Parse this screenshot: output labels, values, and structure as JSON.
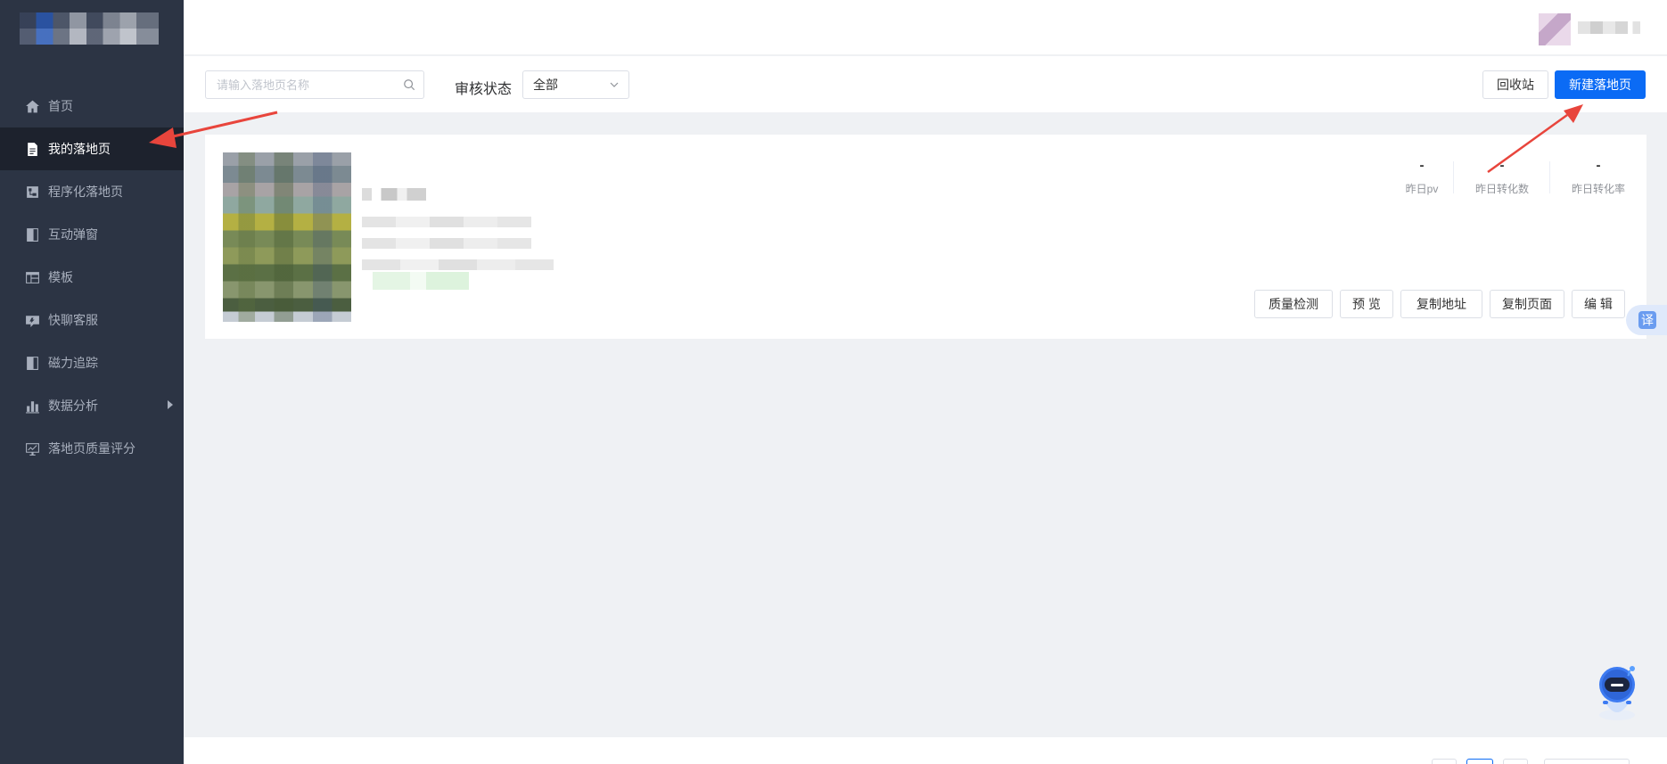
{
  "sidebar": {
    "items": [
      {
        "label": "首页",
        "icon": "home-icon",
        "active": false
      },
      {
        "label": "我的落地页",
        "icon": "document-icon",
        "active": true
      },
      {
        "label": "程序化落地页",
        "icon": "flowchart-icon",
        "active": false
      },
      {
        "label": "互动弹窗",
        "icon": "popup-icon",
        "active": false
      },
      {
        "label": "模板",
        "icon": "template-icon",
        "active": false
      },
      {
        "label": "快聊客服",
        "icon": "chat-icon",
        "active": false
      },
      {
        "label": "磁力追踪",
        "icon": "tracking-icon",
        "active": false
      },
      {
        "label": "数据分析",
        "icon": "bar-chart-icon",
        "active": false,
        "has_submenu": true
      },
      {
        "label": "落地页质量评分",
        "icon": "monitor-chart-icon",
        "active": false
      }
    ]
  },
  "toolbar": {
    "search_placeholder": "请输入落地页名称",
    "status_label": "审核状态",
    "status_value": "全部",
    "recycle_label": "回收站",
    "new_label": "新建落地页"
  },
  "card": {
    "stats": [
      {
        "value": "-",
        "label": "昨日pv"
      },
      {
        "value": "-",
        "label": "昨日转化数"
      },
      {
        "value": "-",
        "label": "昨日转化率"
      }
    ],
    "actions": [
      "质量检测",
      "预 览",
      "复制地址",
      "复制页面",
      "编 辑"
    ]
  },
  "floating": {
    "translate_label": "译"
  },
  "colors": {
    "sidebar_bg": "#2c3444",
    "sidebar_active_bg": "#1d222d",
    "primary": "#0b6bf5",
    "annotation_arrow": "#e8453c"
  }
}
